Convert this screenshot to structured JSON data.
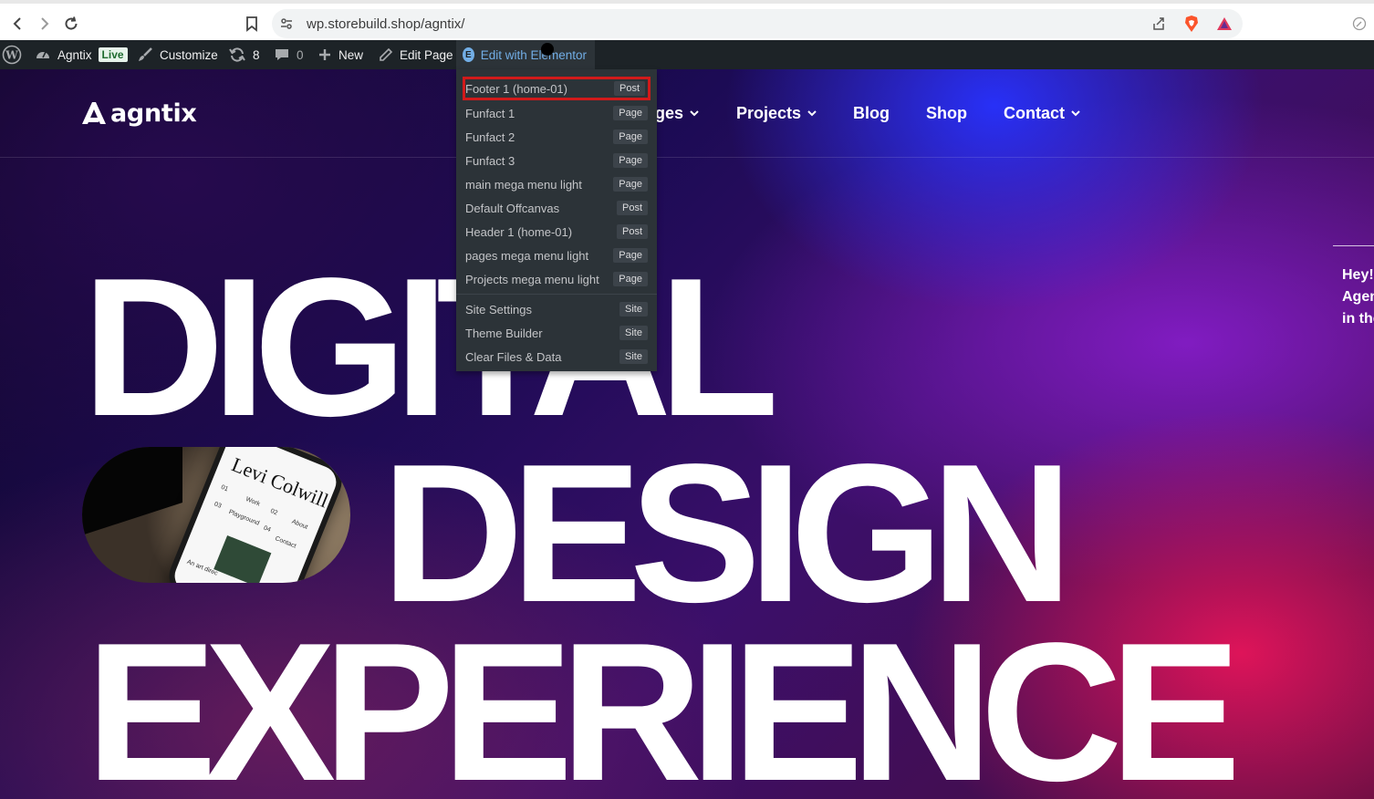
{
  "browser": {
    "url": "wp.storebuild.shop/agntix/"
  },
  "admin_bar": {
    "site_name": "Agntix",
    "live_badge": "Live",
    "customize": "Customize",
    "updates_count": "8",
    "comments_count": "0",
    "new": "New",
    "edit_page": "Edit Page",
    "edit_with_elementor": "Edit with Elementor"
  },
  "elementor_menu": {
    "items": [
      {
        "label": "Footer 1 (home-01)",
        "tag": "Post",
        "highlighted": true
      },
      {
        "label": "Funfact 1",
        "tag": "Page"
      },
      {
        "label": "Funfact 2",
        "tag": "Page"
      },
      {
        "label": "Funfact 3",
        "tag": "Page"
      },
      {
        "label": "main mega menu light",
        "tag": "Page"
      },
      {
        "label": "Default Offcanvas",
        "tag": "Post"
      },
      {
        "label": "Header 1 (home-01)",
        "tag": "Post"
      },
      {
        "label": "pages mega menu light",
        "tag": "Page"
      },
      {
        "label": "Projects mega menu light",
        "tag": "Page"
      }
    ],
    "site_items": [
      {
        "label": "Site Settings",
        "tag": "Site"
      },
      {
        "label": "Theme Builder",
        "tag": "Site"
      },
      {
        "label": "Clear Files & Data",
        "tag": "Site"
      }
    ]
  },
  "site": {
    "logo": "agntix",
    "nav": {
      "pages_partial": "ges",
      "projects": "Projects",
      "blog": "Blog",
      "shop": "Shop",
      "contact": "Contact"
    },
    "side_text": [
      "Hey!",
      "Agen",
      "in the"
    ],
    "hero": {
      "line1": "DIGITAL",
      "line2": "DESIGN",
      "line3": "EXPERIENCE"
    },
    "phone": {
      "name": "Levi Colwill",
      "nav": [
        "01",
        "Work",
        "02",
        "About",
        "03",
        "Playground",
        "04",
        "Contact"
      ],
      "caption": "An art direc"
    }
  },
  "colors": {
    "admin_bar_bg": "#1d2327",
    "admin_link_active": "#72aee6",
    "highlight_outline": "#d11a1a"
  }
}
